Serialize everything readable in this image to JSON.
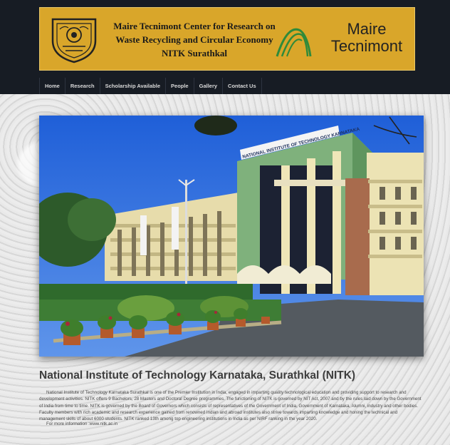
{
  "banner": {
    "title_line1": "Maire Tecnimont Center for Research on",
    "title_line2": "Waste Recycling and Circular Economy",
    "title_line3": "NITK Surathkal",
    "partner_line1": "Maire",
    "partner_line2": "Tecnimont"
  },
  "nav": {
    "items": [
      {
        "label": "Home"
      },
      {
        "label": "Research"
      },
      {
        "label": "Scholarship Available"
      },
      {
        "label": "People"
      },
      {
        "label": "Gallery"
      },
      {
        "label": "Contact Us"
      }
    ]
  },
  "hero": {
    "building_sign": "NATIONAL INSTITUTE OF TECHNOLOGY KARNATAKA"
  },
  "main": {
    "title": "National Institute of Technology Karnataka, Surathkal (NITK)",
    "description": "National Institute of Technology Karnataka Surathkal is one of the Premier Institution in India, engaged in imparting quality technological education and providing support to research and development activities. NITK offers 9 Bachelors, 28 Masters and Doctoral Degree programmes. The functioning of NITK is governed by NIT Act, 2007 and by the rules laid down by the Government of India from time to time. NITK is governed by the Board of Governors which consists of representatives of the Government of India, Government of Karnataka, Alumni, industry and other bodies. Faculty members with rich academic and research experience gained from renowned Indian and abroad institutes also strive towards imparting knowledge and honing the technical and management skills of about 6000 students. NITK ranked 13th among top engineering institutions in India as per NIRF ranking in the year 2020.",
    "more_info": "For more information :www.nitk.ac.in"
  },
  "colors": {
    "header_bg": "#171c24",
    "banner_gold": "#d9a62a",
    "brand_green": "#2f8a3a"
  }
}
